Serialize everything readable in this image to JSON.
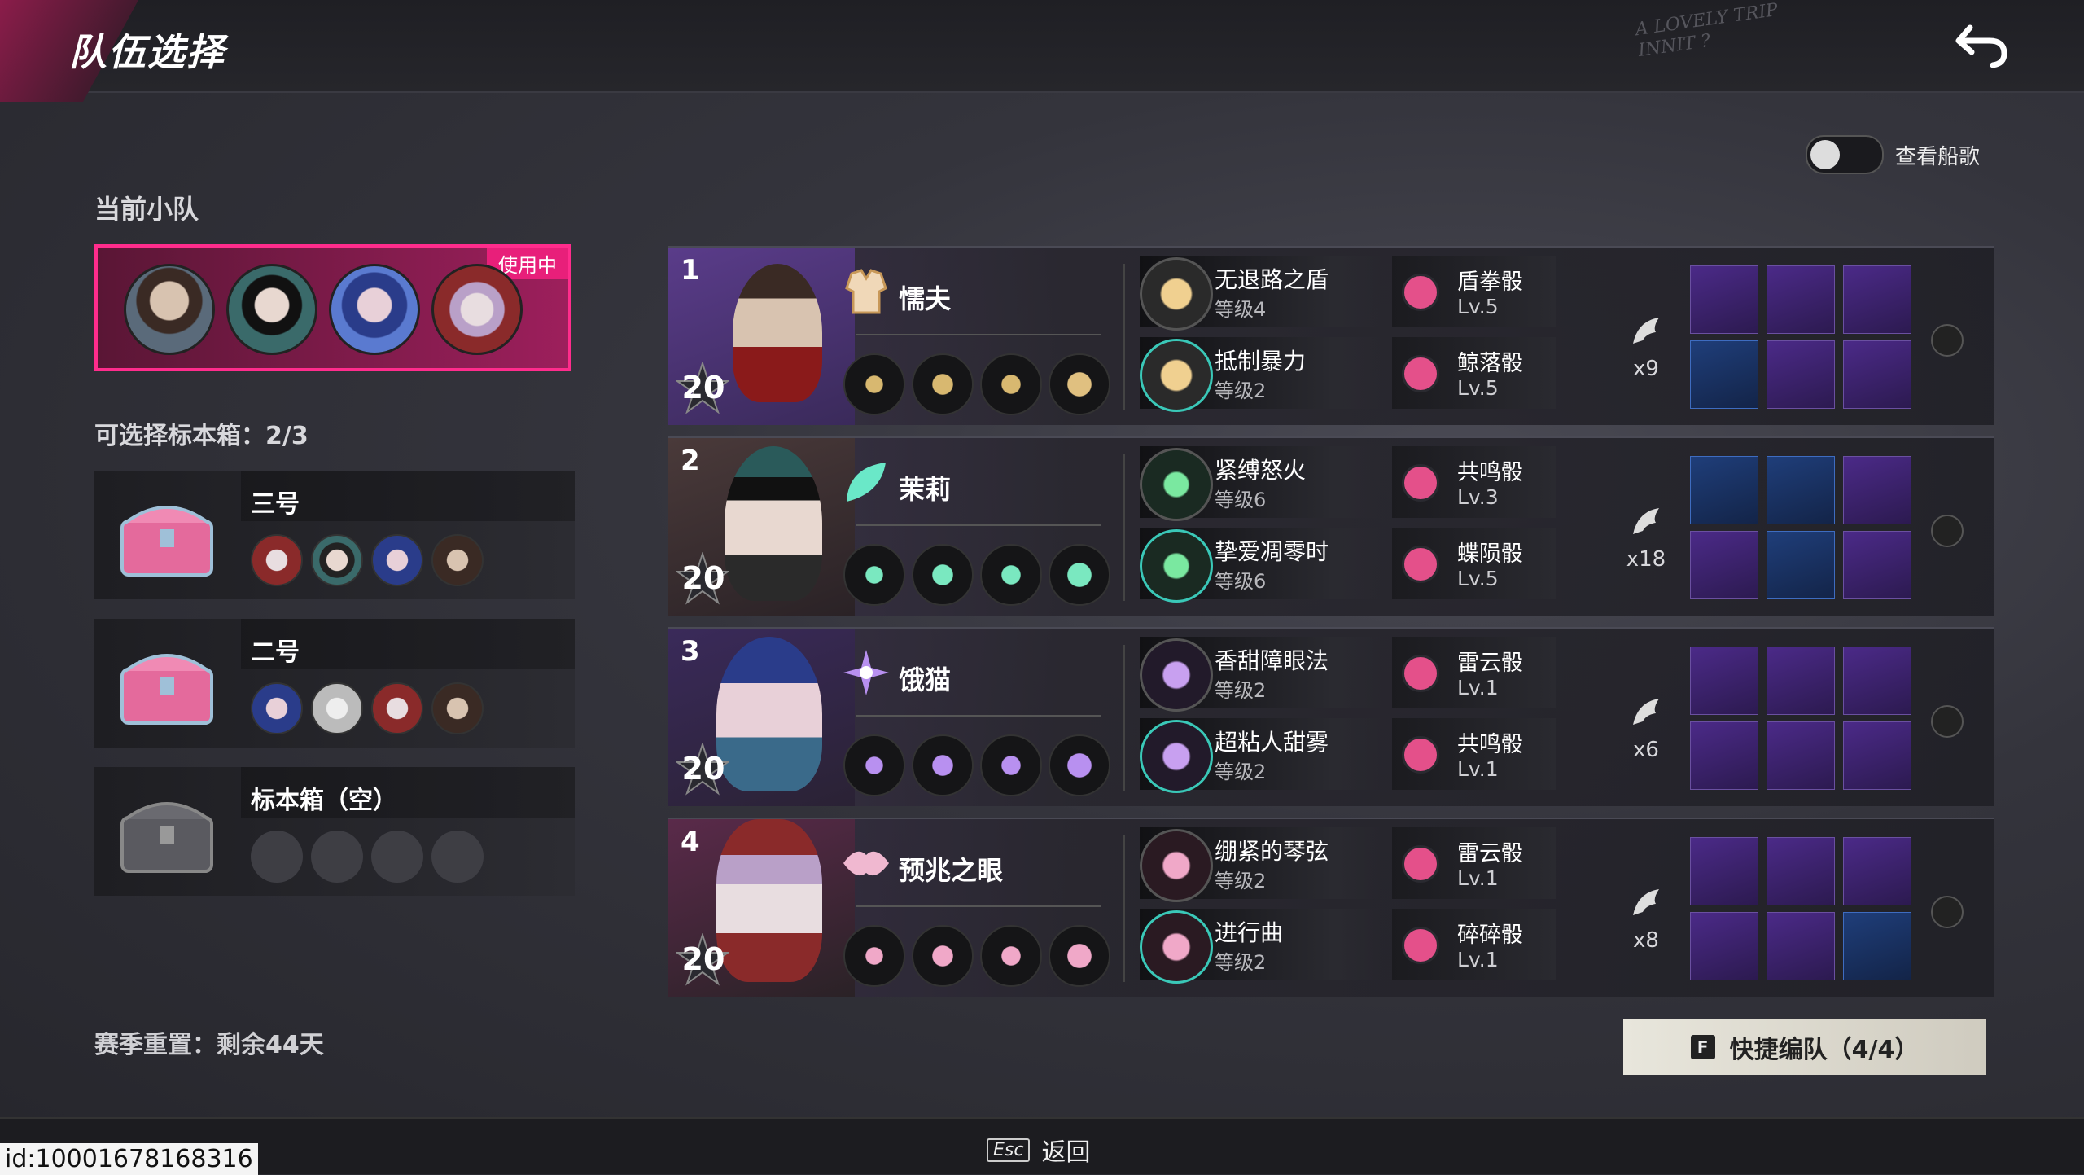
{
  "header": {
    "title": "队伍选择",
    "scribble": "A LOVELY TRIP\nINNIT ?",
    "back_icon": "undo-arrow-icon"
  },
  "toggle": {
    "label": "查看船歌",
    "on": false
  },
  "current_team": {
    "section_title": "当前小队",
    "in_use_label": "使用中",
    "portraits": [
      "coward-portrait",
      "jasmine-portrait",
      "hungry-cat-portrait",
      "omen-eye-portrait"
    ]
  },
  "boxes": {
    "count_label": "可选择标本箱：2/3",
    "items": [
      {
        "title": "三号",
        "members": [
          "omen-eye",
          "jasmine",
          "hungry-cat",
          "coward"
        ],
        "chest": "pink-chest-icon"
      },
      {
        "title": "二号",
        "members": [
          "hungry-cat",
          "white-hair",
          "omen-eye",
          "coward"
        ],
        "chest": "pink-chest-icon"
      },
      {
        "title": "标本箱（空）",
        "members": [],
        "chest": "grey-chest-icon"
      }
    ]
  },
  "season": {
    "label": "赛季重置：剩余44天"
  },
  "characters": [
    {
      "index": "1",
      "name": "懦夫",
      "level": "20",
      "class_icon": "vest-icon",
      "traits": [
        {
          "name": "无退路之盾",
          "level": "等级4"
        },
        {
          "name": "抵制暴力",
          "level": "等级2"
        }
      ],
      "dice": [
        {
          "name": "盾拳骰",
          "level": "Lv.5"
        },
        {
          "name": "鲸落骰",
          "level": "Lv.5"
        }
      ],
      "multiplier": "x9"
    },
    {
      "index": "2",
      "name": "茉莉",
      "level": "20",
      "class_icon": "leaf-icon",
      "traits": [
        {
          "name": "紧缚怒火",
          "level": "等级6"
        },
        {
          "name": "挚爱凋零时",
          "level": "等级6"
        }
      ],
      "dice": [
        {
          "name": "共鸣骰",
          "level": "Lv.3"
        },
        {
          "name": "蝶陨骰",
          "level": "Lv.5"
        }
      ],
      "multiplier": "x18"
    },
    {
      "index": "3",
      "name": "饿猫",
      "level": "20",
      "class_icon": "eye-star-icon",
      "traits": [
        {
          "name": "香甜障眼法",
          "level": "等级2"
        },
        {
          "name": "超粘人甜雾",
          "level": "等级2"
        }
      ],
      "dice": [
        {
          "name": "雷云骰",
          "level": "Lv.1"
        },
        {
          "name": "共鸣骰",
          "level": "Lv.1"
        }
      ],
      "multiplier": "x6"
    },
    {
      "index": "4",
      "name": "预兆之眼",
      "level": "20",
      "class_icon": "lips-icon",
      "traits": [
        {
          "name": "绷紧的琴弦",
          "level": "等级2"
        },
        {
          "name": "进行曲",
          "level": "等级2"
        }
      ],
      "dice": [
        {
          "name": "雷云骰",
          "level": "Lv.1"
        },
        {
          "name": "碎碎骰",
          "level": "Lv.1"
        }
      ],
      "multiplier": "x8"
    }
  ],
  "quick_team": {
    "key": "F",
    "label": "快捷编队（4/4）"
  },
  "footer": {
    "esc_key": "Esc",
    "back_label": "返回",
    "user_id": "id:10001678168316"
  },
  "colors": {
    "accent": "#e81f7a",
    "team_bg": "#9d1f5c",
    "dice": "#e4508a",
    "item_purple": "#4b2a88"
  }
}
